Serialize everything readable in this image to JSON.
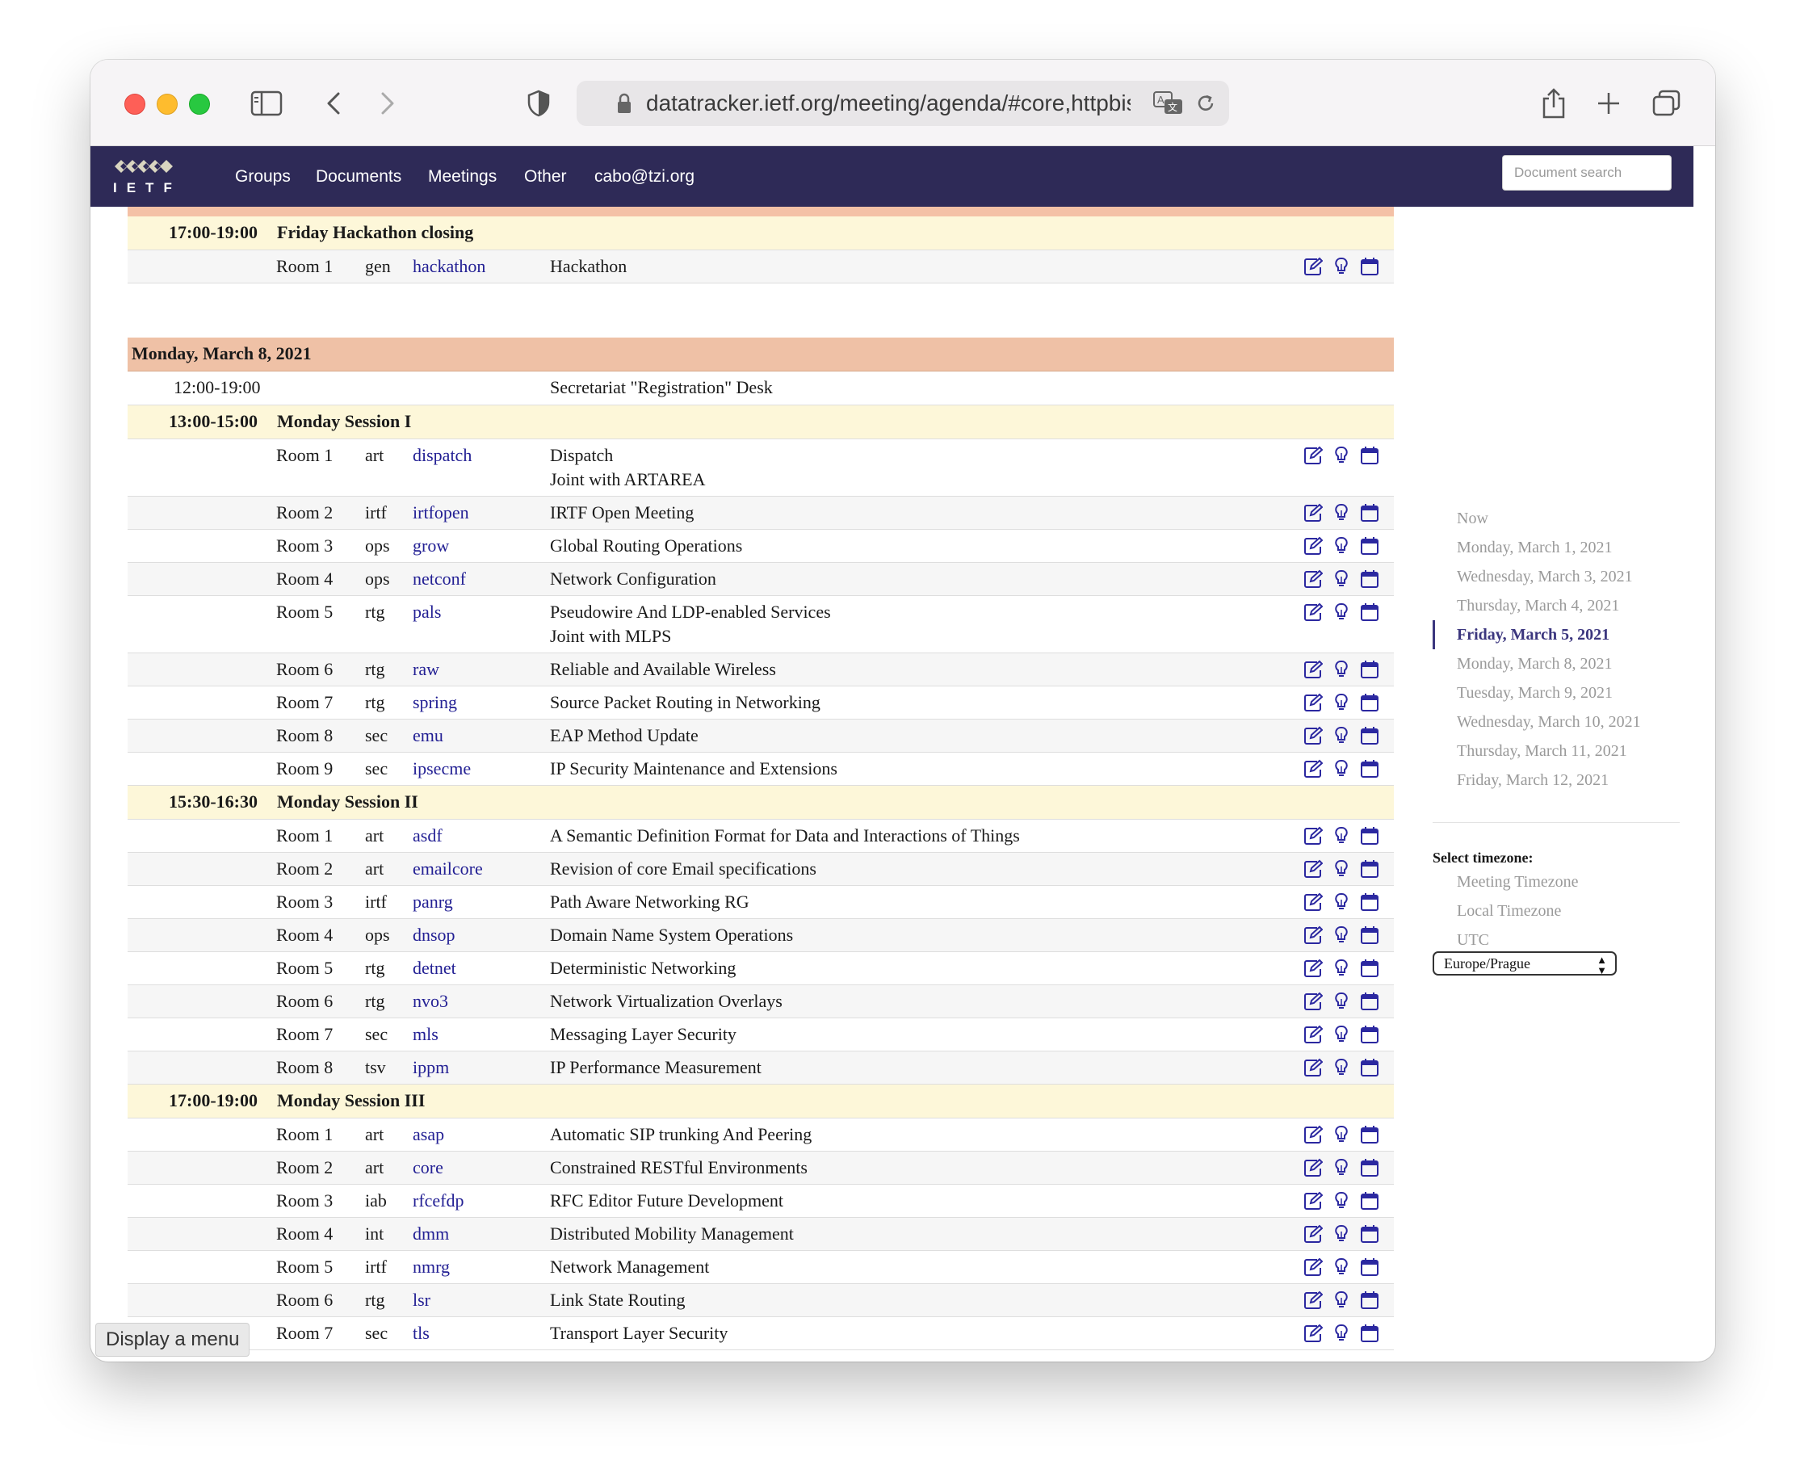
{
  "browser": {
    "url": "datatracker.ietf.org/meeting/agenda/#core,httpbis,"
  },
  "navbar": {
    "logo_text": "IETF",
    "items": [
      "Groups",
      "Documents",
      "Meetings",
      "Other",
      "cabo@tzi.org"
    ],
    "search_placeholder": "Document search"
  },
  "agenda": {
    "friday_session": {
      "time": "17:00-19:00",
      "title": "Friday Hackathon closing",
      "rows": [
        {
          "room": "Room 1",
          "area": "gen",
          "group": "hackathon",
          "title": "Hackathon"
        }
      ]
    },
    "monday": {
      "day": "Monday, March 8, 2021",
      "registration": {
        "time": "12:00-19:00",
        "title": "Secretariat \"Registration\" Desk"
      },
      "sessions": [
        {
          "time": "13:00-15:00",
          "title": "Monday Session I",
          "rows": [
            {
              "room": "Room 1",
              "area": "art",
              "group": "dispatch",
              "title": "Dispatch",
              "note": "Joint with ARTAREA"
            },
            {
              "room": "Room 2",
              "area": "irtf",
              "group": "irtfopen",
              "title": "IRTF Open Meeting"
            },
            {
              "room": "Room 3",
              "area": "ops",
              "group": "grow",
              "title": "Global Routing Operations"
            },
            {
              "room": "Room 4",
              "area": "ops",
              "group": "netconf",
              "title": "Network Configuration"
            },
            {
              "room": "Room 5",
              "area": "rtg",
              "group": "pals",
              "title": "Pseudowire And LDP-enabled Services",
              "note": "Joint with MLPS"
            },
            {
              "room": "Room 6",
              "area": "rtg",
              "group": "raw",
              "title": "Reliable and Available Wireless"
            },
            {
              "room": "Room 7",
              "area": "rtg",
              "group": "spring",
              "title": "Source Packet Routing in Networking"
            },
            {
              "room": "Room 8",
              "area": "sec",
              "group": "emu",
              "title": "EAP Method Update"
            },
            {
              "room": "Room 9",
              "area": "sec",
              "group": "ipsecme",
              "title": "IP Security Maintenance and Extensions"
            }
          ]
        },
        {
          "time": "15:30-16:30",
          "title": "Monday Session II",
          "rows": [
            {
              "room": "Room 1",
              "area": "art",
              "group": "asdf",
              "title": "A Semantic Definition Format for Data and Interactions of Things"
            },
            {
              "room": "Room 2",
              "area": "art",
              "group": "emailcore",
              "title": "Revision of core Email specifications"
            },
            {
              "room": "Room 3",
              "area": "irtf",
              "group": "panrg",
              "title": "Path Aware Networking RG"
            },
            {
              "room": "Room 4",
              "area": "ops",
              "group": "dnsop",
              "title": "Domain Name System Operations"
            },
            {
              "room": "Room 5",
              "area": "rtg",
              "group": "detnet",
              "title": "Deterministic Networking"
            },
            {
              "room": "Room 6",
              "area": "rtg",
              "group": "nvo3",
              "title": "Network Virtualization Overlays"
            },
            {
              "room": "Room 7",
              "area": "sec",
              "group": "mls",
              "title": "Messaging Layer Security"
            },
            {
              "room": "Room 8",
              "area": "tsv",
              "group": "ippm",
              "title": "IP Performance Measurement"
            }
          ]
        },
        {
          "time": "17:00-19:00",
          "title": "Monday Session III",
          "rows": [
            {
              "room": "Room 1",
              "area": "art",
              "group": "asap",
              "title": "Automatic SIP trunking And Peering"
            },
            {
              "room": "Room 2",
              "area": "art",
              "group": "core",
              "title": "Constrained RESTful Environments"
            },
            {
              "room": "Room 3",
              "area": "iab",
              "group": "rfcefdp",
              "title": "RFC Editor Future Development"
            },
            {
              "room": "Room 4",
              "area": "int",
              "group": "dmm",
              "title": "Distributed Mobility Management"
            },
            {
              "room": "Room 5",
              "area": "irtf",
              "group": "nmrg",
              "title": "Network Management"
            },
            {
              "room": "Room 6",
              "area": "rtg",
              "group": "lsr",
              "title": "Link State Routing"
            },
            {
              "room": "Room 7",
              "area": "sec",
              "group": "tls",
              "title": "Transport Layer Security"
            }
          ]
        }
      ]
    }
  },
  "sidebar": {
    "dates": [
      "Now",
      "Monday, March 1, 2021",
      "Wednesday, March 3, 2021",
      "Thursday, March 4, 2021",
      "Friday, March 5, 2021",
      "Monday, March 8, 2021",
      "Tuesday, March 9, 2021",
      "Wednesday, March 10, 2021",
      "Thursday, March 11, 2021",
      "Friday, March 12, 2021"
    ],
    "active_date": "Friday, March 5, 2021",
    "timezone_label": "Select timezone:",
    "timezones": [
      "Meeting Timezone",
      "Local Timezone",
      "UTC"
    ],
    "timezone_selected": "Europe/Prague"
  },
  "tooltip": "Display a menu",
  "colors": {
    "navbar": "#2e2a57",
    "day_header": "#efc1a6",
    "session_header": "#fdf7d9",
    "link": "#232094",
    "active_date": "#3b367e"
  }
}
